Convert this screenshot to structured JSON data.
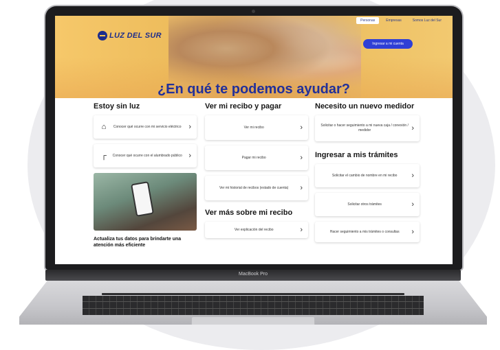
{
  "nav": {
    "personas": "Personas",
    "empresas": "Empresas",
    "somos": "Somos Luz del Sur"
  },
  "brand": {
    "logo_text": "LUZ DEL SUR",
    "login_label": "Ingresar a mi cuenta"
  },
  "hero": {
    "title": "¿En qué te podemos ayudar?"
  },
  "col1": {
    "title": "Estoy sin luz",
    "items": [
      {
        "icon": "house-icon",
        "label": "Conocer qué ocurre con mi servicio eléctrico"
      },
      {
        "icon": "streetlight-icon",
        "label": "Conocer qué ocurre con el alumbrado público"
      }
    ],
    "promo_text": "Actualiza tus datos para brindarte una atención más eficiente"
  },
  "col2": {
    "title": "Ver mi recibo y pagar",
    "items": [
      "Ver mi recibo",
      "Pagar mi recibo",
      "Ver mi historial de recibos (estado de cuenta)"
    ],
    "title2": "Ver más sobre mi recibo",
    "items2": [
      "Ver explicación del recibo"
    ]
  },
  "col3": {
    "title": "Necesito un nuevo medidor",
    "items": [
      "Solicitar o hacer seguimiento a mi nueva caja / conexión / medidor"
    ],
    "title2": "Ingresar a mis trámites",
    "items2": [
      "Solicitar el cambio de nombre en mi recibo",
      "Solicitar otros trámites",
      "Hacer seguimiento a mis trámites o consultas"
    ]
  },
  "laptop": {
    "model": "MacBook Pro"
  }
}
